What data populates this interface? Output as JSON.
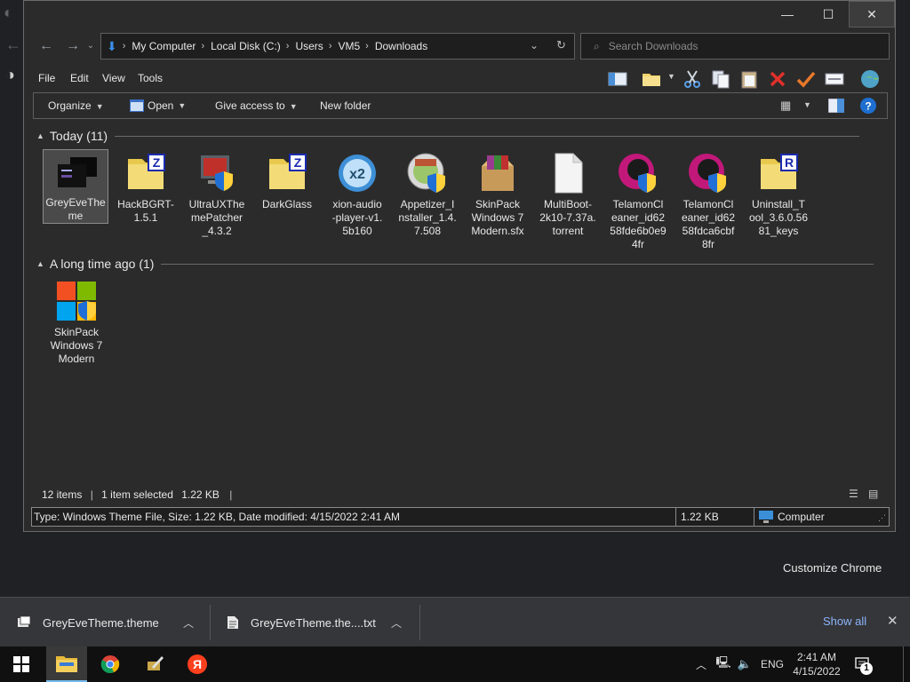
{
  "explorer": {
    "window_buttons": {
      "minimize": "—",
      "maximize": "☐",
      "close": "✕"
    },
    "address": {
      "crumbs": [
        "My Computer",
        "Local Disk (C:)",
        "Users",
        "VM5",
        "Downloads"
      ]
    },
    "search_placeholder": "Search Downloads",
    "menu": [
      "File",
      "Edit",
      "View",
      "Tools"
    ],
    "commands": {
      "organize": "Organize",
      "open": "Open",
      "give_access": "Give access to",
      "new_folder": "New folder"
    },
    "groups": [
      {
        "title": "Today (11)",
        "files": [
          {
            "name": "GreyEveTheme",
            "icon": "theme-file-icon",
            "selected": true
          },
          {
            "name": "HackBGRT-1.5.1",
            "icon": "zip-folder-icon"
          },
          {
            "name": "UltraUXThemePatcher_4.3.2",
            "icon": "installer-shield-icon"
          },
          {
            "name": "DarkGlass",
            "icon": "zip-folder-icon"
          },
          {
            "name": "xion-audio-player-v1.5b160",
            "icon": "xion-player-icon"
          },
          {
            "name": "Appetizer_Installer_1.4.7.508",
            "icon": "appetizer-installer-icon"
          },
          {
            "name": "SkinPack Windows 7 Modern.sfx",
            "icon": "winrar-archive-icon"
          },
          {
            "name": "MultiBoot-2k10-7.37a.torrent",
            "icon": "blank-file-icon"
          },
          {
            "name": "TelamonCleaner_id6258fde6b0e94fr",
            "icon": "telamon-cleaner-icon"
          },
          {
            "name": "TelamonCleaner_id6258fdca6cbf8fr",
            "icon": "telamon-cleaner-icon"
          },
          {
            "name": "Uninstall_Tool_3.6.0.5681_keys",
            "icon": "rar-folder-icon"
          }
        ]
      },
      {
        "title": "A long time ago (1)",
        "files": [
          {
            "name": "SkinPack Windows 7 Modern",
            "icon": "windows-logo-shield-icon"
          }
        ]
      }
    ],
    "file_labels": {
      "f0": "GreyEveThe\nme",
      "f1": "HackBGRT-\n1.5.1",
      "f2": "UltraUXThe\nmePatcher\n_4.3.2",
      "f3": "DarkGlass",
      "f4": "xion-audio\n-player-v1.\n5b160",
      "f5": "Appetizer_I\nnstaller_1.4.\n7.508",
      "f6": "SkinPack\nWindows 7\nModern.sfx",
      "f7": "MultiBoot-\n2k10-7.37a.\ntorrent",
      "f8": "TelamonCl\neaner_id62\n58fde6b0e9\n4fr",
      "f9": "TelamonCl\neaner_id62\n58fdca6cbf\n8fr",
      "f10": "Uninstall_T\nool_3.6.0.56\n81_keys",
      "g0": "SkinPack\nWindows 7\nModern"
    },
    "status": {
      "items": "12 items",
      "selected": "1 item selected",
      "size": "1.22 KB"
    },
    "statusbar": {
      "details": "Type: Windows Theme File, Size: 1.22 KB, Date modified: 4/15/2022 2:41 AM",
      "size": "1.22 KB",
      "location": "Computer"
    }
  },
  "chrome": {
    "customize_label": "Customize Chrome",
    "downloads": [
      {
        "name": "GreyEveTheme.theme"
      },
      {
        "name": "GreyEveTheme.the....txt"
      }
    ],
    "show_all": "Show all"
  },
  "taskbar": {
    "lang": "ENG",
    "time": "2:41 AM",
    "date": "4/15/2022",
    "notification_count": "1"
  },
  "colors": {
    "accent_blue": "#1a73e8",
    "yandex_red": "#fc3f1d",
    "shield_blue": "#1f6fd6"
  }
}
